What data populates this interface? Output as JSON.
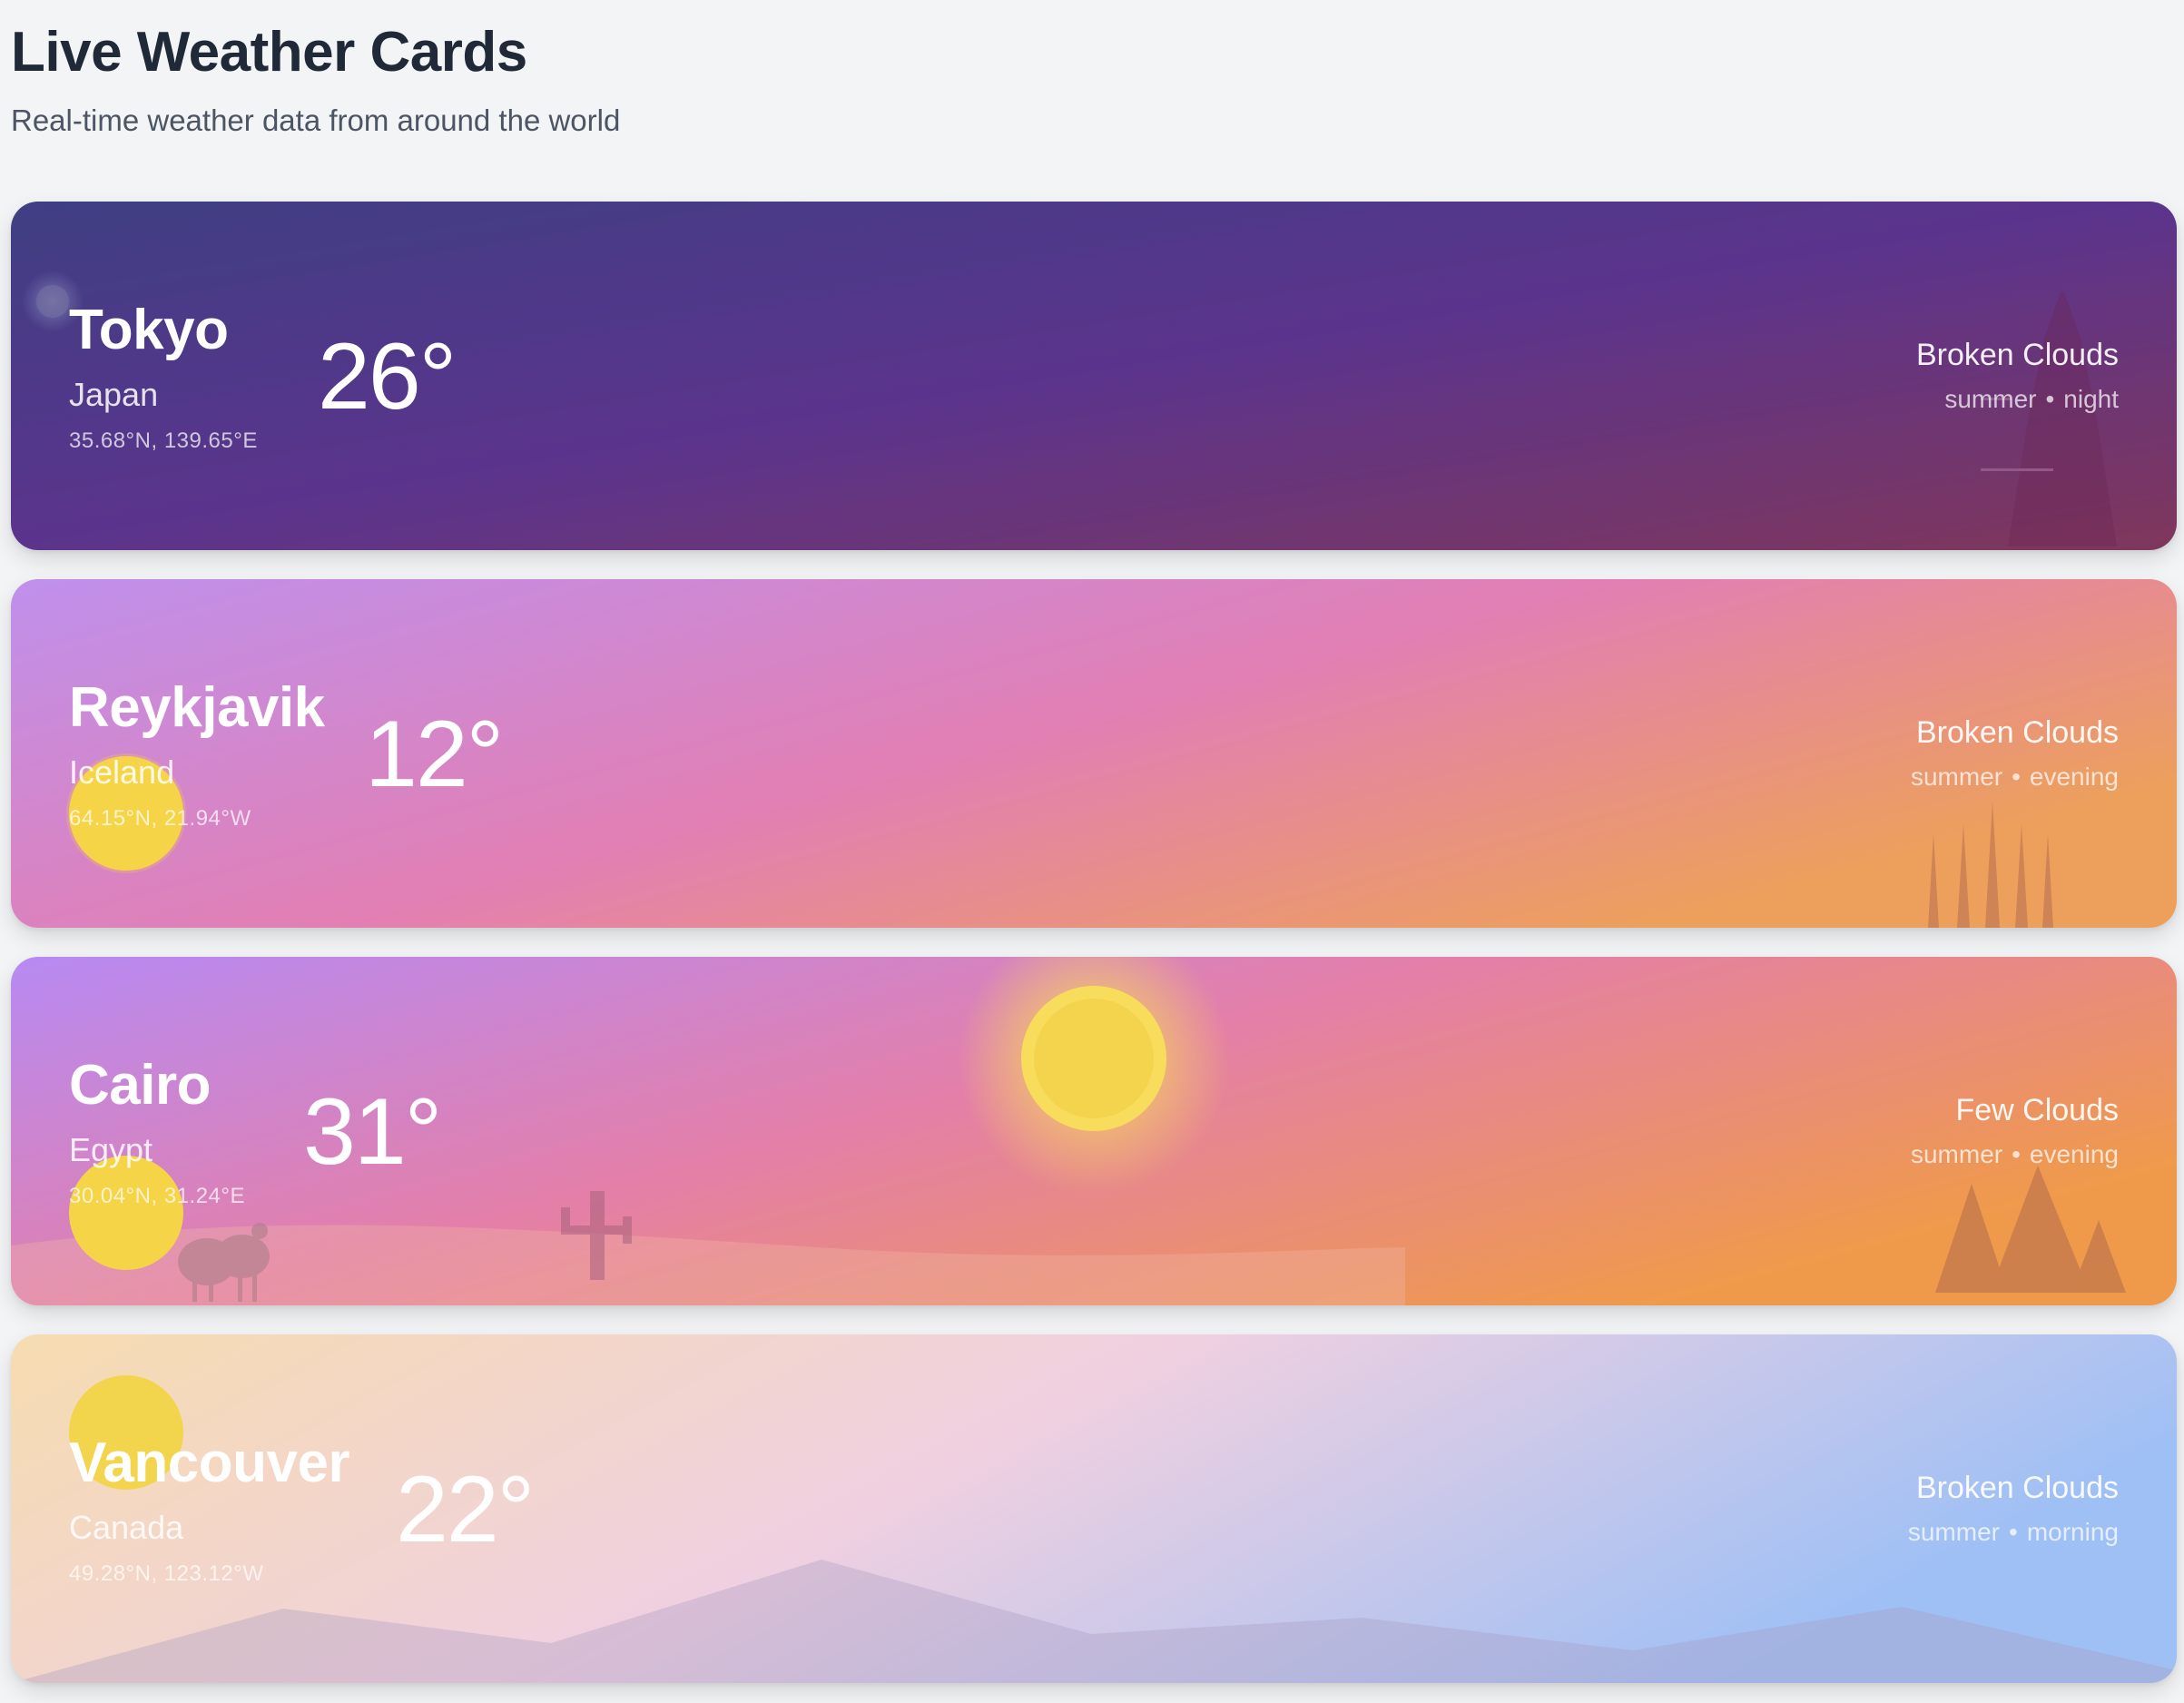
{
  "header": {
    "title": "Live Weather Cards",
    "subtitle": "Real-time weather data from around the world"
  },
  "cards": [
    {
      "city": "Tokyo",
      "country": "Japan",
      "coords": "35.68°N, 139.65°E",
      "temperature": "26°",
      "condition": "Broken Clouds",
      "season": "summer",
      "time_of_day": "night",
      "separator": "•",
      "colors": [
        "#2f2f79",
        "#4e2383",
        "#75264e"
      ],
      "scene_icons": [
        "moon-icon",
        "pagoda-icon"
      ]
    },
    {
      "city": "Reykjavik",
      "country": "Iceland",
      "coords": "64.15°N, 21.94°W",
      "temperature": "12°",
      "condition": "Broken Clouds",
      "season": "summer",
      "time_of_day": "evening",
      "separator": "•",
      "colors": [
        "#bf90ec",
        "#e27fb3",
        "#eda05b"
      ],
      "scene_icons": [
        "sun-icon",
        "church-spires-icon"
      ]
    },
    {
      "city": "Cairo",
      "country": "Egypt",
      "coords": "30.04°N, 31.24°E",
      "temperature": "31°",
      "condition": "Few Clouds",
      "season": "summer",
      "time_of_day": "evening",
      "separator": "•",
      "colors": [
        "#b78af3",
        "#e47fa8",
        "#ef9a4b"
      ],
      "scene_icons": [
        "sun-icon",
        "camel-icon",
        "cactus-icon",
        "pyramids-icon"
      ]
    },
    {
      "city": "Vancouver",
      "country": "Canada",
      "coords": "49.28°N, 123.12°W",
      "temperature": "22°",
      "condition": "Broken Clouds",
      "season": "summer",
      "time_of_day": "morning",
      "separator": "•",
      "colors": [
        "#f6dcb0",
        "#f0d0e0",
        "#9fc0f5"
      ],
      "scene_icons": [
        "sun-icon",
        "mountains-icon"
      ]
    }
  ]
}
